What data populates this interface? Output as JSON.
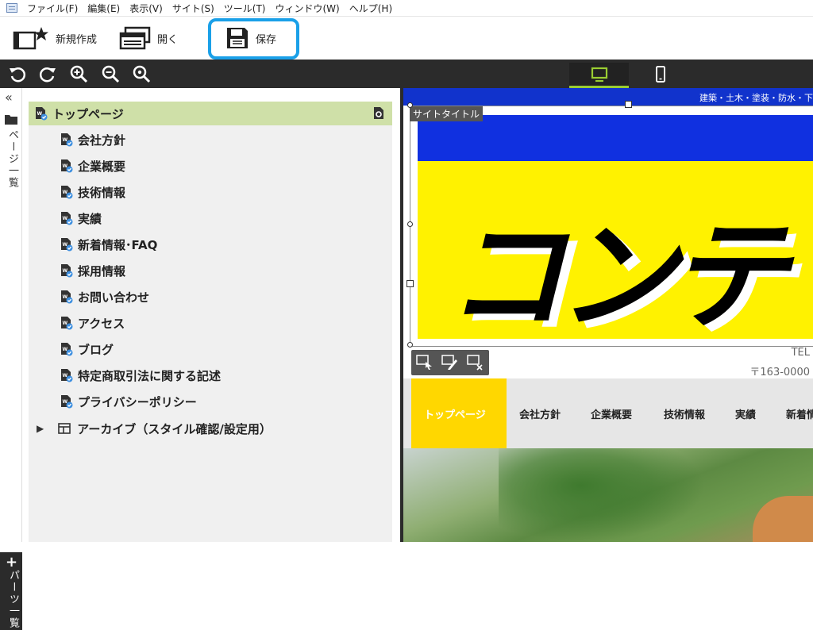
{
  "menu": [
    "ファイル(F)",
    "編集(E)",
    "表示(V)",
    "サイト(S)",
    "ツール(T)",
    "ウィンドウ(W)",
    "ヘルプ(H)"
  ],
  "toolbar": {
    "new_label": "新規作成",
    "open_label": "開く",
    "save_label": "保存"
  },
  "sidebar": {
    "pages_tab": "ページ一覧",
    "parts_tab": "パーツ一覧"
  },
  "tree": {
    "root": "トップページ",
    "items": [
      "会社方針",
      "企業概要",
      "技術情報",
      "実績",
      "新着情報･FAQ",
      "採用情報",
      "お問い合わせ",
      "アクセス",
      "ブログ",
      "特定商取引法に関する記述",
      "プライバシーポリシー"
    ],
    "archive": "アーカイブ（スタイル確認/設定用）"
  },
  "preview": {
    "topline": "建築・土木・塗装・防水・下",
    "site_title_tag": "サイトタイトル",
    "hero_text": "コンテ",
    "tel": "TEL",
    "postal": "〒163-0000",
    "nav": [
      "トップページ",
      "会社方針",
      "企業概要",
      "技術情報",
      "実績",
      "新着情"
    ]
  },
  "colors": {
    "accent_highlight": "#1aa0e8",
    "selected_row": "#cfe0a8",
    "hero_yellow": "#fff200",
    "hero_blue": "#1030e0",
    "nav_active": "#ffd700"
  },
  "icons": [
    "new-file-icon",
    "open-icon",
    "save-icon",
    "undo-icon",
    "redo-icon",
    "zoom-in-icon",
    "zoom-out-icon",
    "zoom-reset-icon",
    "desktop-icon",
    "mobile-icon",
    "collapse-icon",
    "folder-icon",
    "plus-icon",
    "page-icon",
    "settings-page-icon",
    "expand-arrow-icon",
    "archive-icon"
  ]
}
